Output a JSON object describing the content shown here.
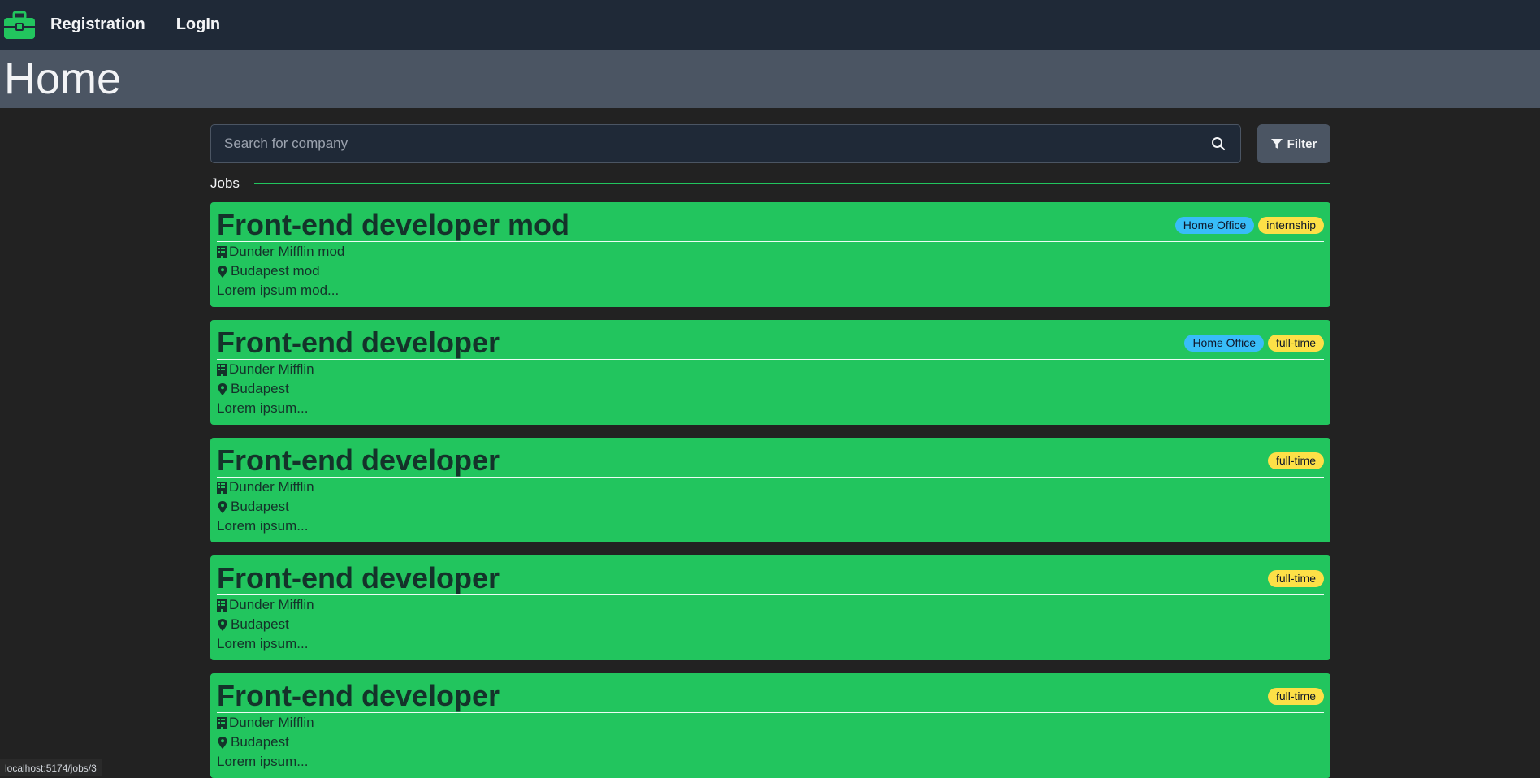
{
  "nav": {
    "registration": "Registration",
    "login": "LogIn"
  },
  "page": {
    "title": "Home"
  },
  "search": {
    "placeholder": "Search for company",
    "filter_label": "Filter"
  },
  "section": {
    "jobs_label": "Jobs"
  },
  "jobs": [
    {
      "title": "Front-end developer mod",
      "company": "Dunder Mifflin mod",
      "location": "Budapest mod",
      "description": "Lorem ipsum mod...",
      "badges": [
        "Home Office",
        "internship"
      ]
    },
    {
      "title": "Front-end developer",
      "company": "Dunder Mifflin",
      "location": "Budapest",
      "description": "Lorem ipsum...",
      "badges": [
        "Home Office",
        "full-time"
      ]
    },
    {
      "title": "Front-end developer",
      "company": "Dunder Mifflin",
      "location": "Budapest",
      "description": "Lorem ipsum...",
      "badges": [
        "full-time"
      ]
    },
    {
      "title": "Front-end developer",
      "company": "Dunder Mifflin",
      "location": "Budapest",
      "description": "Lorem ipsum...",
      "badges": [
        "full-time"
      ]
    },
    {
      "title": "Front-end developer",
      "company": "Dunder Mifflin",
      "location": "Budapest",
      "description": "Lorem ipsum...",
      "badges": [
        "full-time"
      ]
    }
  ],
  "status": {
    "url": "localhost:5174/jobs/3"
  },
  "colors": {
    "accent": "#22c55e",
    "nav_bg": "#1f2937",
    "header_bg": "#4b5563",
    "page_bg": "#222222",
    "badge_blue": "#38bdf8",
    "badge_yellow": "#fde047"
  },
  "icons": {
    "logo": "briefcase-icon",
    "search": "search-icon",
    "filter": "funnel-icon",
    "company": "building-icon",
    "location": "map-pin-icon"
  }
}
